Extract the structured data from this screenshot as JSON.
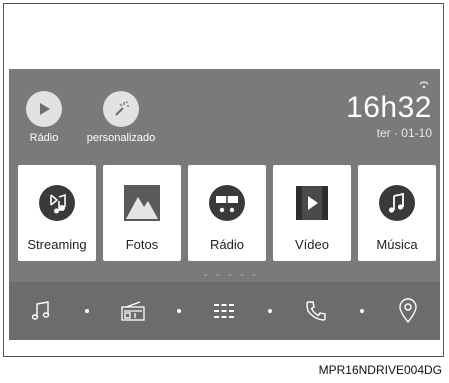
{
  "quick_actions": [
    {
      "label": "Rádio",
      "icon": "play-icon"
    },
    {
      "label": "personalizado",
      "icon": "magic-wand-icon"
    }
  ],
  "clock": {
    "time": "16h32",
    "date": "ter · 01-10",
    "status_icon": "signal-icon"
  },
  "apps": [
    {
      "label": "Streaming",
      "icon": "bluetooth-music-icon"
    },
    {
      "label": "Fotos",
      "icon": "photos-icon"
    },
    {
      "label": "Rádio",
      "icon": "radio-dial-icon"
    },
    {
      "label": "Vídeo",
      "icon": "video-icon"
    },
    {
      "label": "Música",
      "icon": "music-note-icon"
    }
  ],
  "pager": "- - - - -",
  "dock": [
    {
      "name": "music-icon"
    },
    {
      "name": "radio-icon"
    },
    {
      "name": "apps-grid-icon"
    },
    {
      "name": "phone-icon"
    },
    {
      "name": "location-pin-icon"
    }
  ],
  "caption": "MPR16NDRIVE004DG",
  "colors": {
    "screen_bg": "#7a7a7a",
    "dock_bg": "#6c6c6c",
    "tile_bg": "#ffffff",
    "icon_dark": "#3a3a3a"
  }
}
